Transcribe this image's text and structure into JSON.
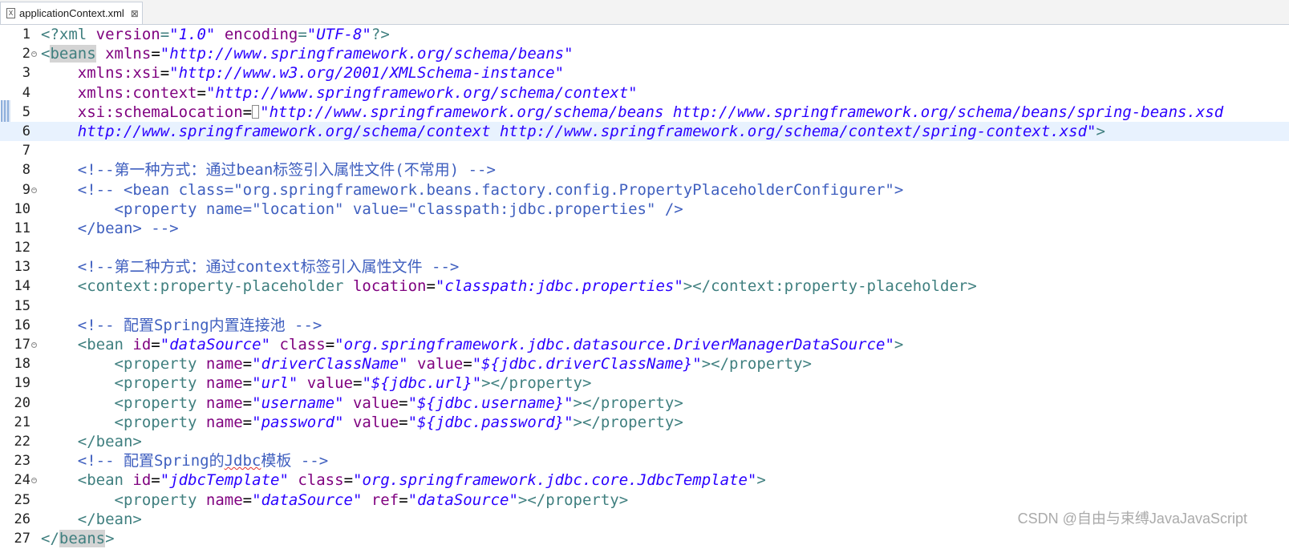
{
  "tab": {
    "file_name": "applicationContext.xml",
    "close_glyph": "⊠",
    "icon_letter": "X"
  },
  "editor": {
    "lines": [
      {
        "n": "1",
        "code": [
          [
            "pi",
            "<?xml "
          ],
          [
            "attr",
            "version"
          ],
          [
            "pi",
            "="
          ],
          [
            "val",
            "\"1.0\""
          ],
          [
            "pi",
            " "
          ],
          [
            "attr",
            "encoding"
          ],
          [
            "pi",
            "="
          ],
          [
            "val",
            "\"UTF-8\""
          ],
          [
            "pi",
            "?>"
          ]
        ]
      },
      {
        "n": "2",
        "fold": true,
        "code": [
          [
            "tag",
            "<"
          ],
          [
            "taghl",
            "beans"
          ],
          [
            "tag",
            " "
          ],
          [
            "attr",
            "xmlns"
          ],
          [
            "plain",
            "="
          ],
          [
            "val",
            "\"http://www.springframework.org/schema/beans\""
          ]
        ]
      },
      {
        "n": "3",
        "code": [
          [
            "plain",
            "    "
          ],
          [
            "attr",
            "xmlns:xsi"
          ],
          [
            "plain",
            "="
          ],
          [
            "val",
            "\"http://www.w3.org/2001/XMLSchema-instance\""
          ]
        ]
      },
      {
        "n": "4",
        "code": [
          [
            "plain",
            "    "
          ],
          [
            "attr",
            "xmlns:context"
          ],
          [
            "plain",
            "="
          ],
          [
            "val",
            "\"http://www.springframework.org/schema/context\""
          ]
        ]
      },
      {
        "n": "5",
        "code": [
          [
            "plain",
            "    "
          ],
          [
            "attr",
            "xsi:schemaLocation"
          ],
          [
            "plain",
            "="
          ],
          [
            "caret",
            ""
          ],
          [
            "val",
            "\"http://www.springframework.org/schema/beans http://www.springframework.org/schema/beans/spring-beans.xsd"
          ]
        ]
      },
      {
        "n": "6",
        "current": true,
        "code": [
          [
            "plain",
            "    "
          ],
          [
            "val",
            "http://www.springframework.org/schema/context http://www.springframework.org/schema/context/spring-context.xsd\""
          ],
          [
            "tag",
            ">"
          ]
        ]
      },
      {
        "n": "7",
        "code": []
      },
      {
        "n": "8",
        "code": [
          [
            "plain",
            "    "
          ],
          [
            "cmt",
            "<!--第一种方式：通过bean标签引入属性文件(不常用) -->"
          ]
        ]
      },
      {
        "n": "9",
        "fold": true,
        "code": [
          [
            "plain",
            "    "
          ],
          [
            "cmt",
            "<!-- <bean class=\"org.springframework.beans.factory.config.PropertyPlaceholderConfigurer\">"
          ]
        ]
      },
      {
        "n": "10",
        "code": [
          [
            "plain",
            "        "
          ],
          [
            "cmt",
            "<property name=\"location\" value=\"classpath:jdbc.properties\" />"
          ]
        ]
      },
      {
        "n": "11",
        "code": [
          [
            "plain",
            "    "
          ],
          [
            "cmt",
            "</bean> -->"
          ]
        ]
      },
      {
        "n": "12",
        "code": []
      },
      {
        "n": "13",
        "code": [
          [
            "plain",
            "    "
          ],
          [
            "cmt",
            "<!--第二种方式：通过context标签引入属性文件 -->"
          ]
        ]
      },
      {
        "n": "14",
        "code": [
          [
            "plain",
            "    "
          ],
          [
            "tag",
            "<context:property-placeholder "
          ],
          [
            "attr",
            "location"
          ],
          [
            "plain",
            "="
          ],
          [
            "val",
            "\"classpath:jdbc.properties\""
          ],
          [
            "tag",
            "></context:property-placeholder>"
          ]
        ]
      },
      {
        "n": "15",
        "code": []
      },
      {
        "n": "16",
        "code": [
          [
            "plain",
            "    "
          ],
          [
            "cmt",
            "<!-- 配置Spring内置连接池 -->"
          ]
        ]
      },
      {
        "n": "17",
        "fold": true,
        "code": [
          [
            "plain",
            "    "
          ],
          [
            "tag",
            "<bean "
          ],
          [
            "attr",
            "id"
          ],
          [
            "plain",
            "="
          ],
          [
            "val",
            "\"dataSource\""
          ],
          [
            "plain",
            " "
          ],
          [
            "attr",
            "class"
          ],
          [
            "plain",
            "="
          ],
          [
            "val",
            "\"org.springframework.jdbc.datasource.DriverManagerDataSource\""
          ],
          [
            "tag",
            ">"
          ]
        ]
      },
      {
        "n": "18",
        "code": [
          [
            "plain",
            "        "
          ],
          [
            "tag",
            "<property "
          ],
          [
            "attr",
            "name"
          ],
          [
            "plain",
            "="
          ],
          [
            "val",
            "\"driverClassName\""
          ],
          [
            "plain",
            " "
          ],
          [
            "attr",
            "value"
          ],
          [
            "plain",
            "="
          ],
          [
            "val",
            "\"${jdbc.driverClassName}\""
          ],
          [
            "tag",
            "></property>"
          ]
        ]
      },
      {
        "n": "19",
        "code": [
          [
            "plain",
            "        "
          ],
          [
            "tag",
            "<property "
          ],
          [
            "attr",
            "name"
          ],
          [
            "plain",
            "="
          ],
          [
            "val",
            "\"url\""
          ],
          [
            "plain",
            " "
          ],
          [
            "attr",
            "value"
          ],
          [
            "plain",
            "="
          ],
          [
            "val",
            "\"${jdbc.url}\""
          ],
          [
            "tag",
            "></property>"
          ]
        ]
      },
      {
        "n": "20",
        "code": [
          [
            "plain",
            "        "
          ],
          [
            "tag",
            "<property "
          ],
          [
            "attr",
            "name"
          ],
          [
            "plain",
            "="
          ],
          [
            "val",
            "\"username\""
          ],
          [
            "plain",
            " "
          ],
          [
            "attr",
            "value"
          ],
          [
            "plain",
            "="
          ],
          [
            "val",
            "\"${jdbc.username}\""
          ],
          [
            "tag",
            "></property>"
          ]
        ]
      },
      {
        "n": "21",
        "code": [
          [
            "plain",
            "        "
          ],
          [
            "tag",
            "<property "
          ],
          [
            "attr",
            "name"
          ],
          [
            "plain",
            "="
          ],
          [
            "val",
            "\"password\""
          ],
          [
            "plain",
            " "
          ],
          [
            "attr",
            "value"
          ],
          [
            "plain",
            "="
          ],
          [
            "val",
            "\"${jdbc.password}\""
          ],
          [
            "tag",
            "></property>"
          ]
        ]
      },
      {
        "n": "22",
        "code": [
          [
            "plain",
            "    "
          ],
          [
            "tag",
            "</bean>"
          ]
        ]
      },
      {
        "n": "23",
        "code": [
          [
            "plain",
            "    "
          ],
          [
            "cmt",
            "<!-- 配置Spring的"
          ],
          [
            "cmtsq",
            "Jdbc"
          ],
          [
            "cmt",
            "模板 -->"
          ]
        ]
      },
      {
        "n": "24",
        "fold": true,
        "code": [
          [
            "plain",
            "    "
          ],
          [
            "tag",
            "<bean "
          ],
          [
            "attr",
            "id"
          ],
          [
            "plain",
            "="
          ],
          [
            "val",
            "\"jdbcTemplate\""
          ],
          [
            "plain",
            " "
          ],
          [
            "attr",
            "class"
          ],
          [
            "plain",
            "="
          ],
          [
            "val",
            "\"org.springframework.jdbc.core.JdbcTemplate\""
          ],
          [
            "tag",
            ">"
          ]
        ]
      },
      {
        "n": "25",
        "code": [
          [
            "plain",
            "        "
          ],
          [
            "tag",
            "<property "
          ],
          [
            "attr",
            "name"
          ],
          [
            "plain",
            "="
          ],
          [
            "val",
            "\"dataSource\""
          ],
          [
            "plain",
            " "
          ],
          [
            "attr",
            "ref"
          ],
          [
            "plain",
            "="
          ],
          [
            "val",
            "\"dataSource\""
          ],
          [
            "tag",
            "></property>"
          ]
        ]
      },
      {
        "n": "26",
        "code": [
          [
            "plain",
            "    "
          ],
          [
            "tag",
            "</bean>"
          ]
        ]
      },
      {
        "n": "27",
        "code": [
          [
            "tag",
            "</"
          ],
          [
            "taghl",
            "beans"
          ],
          [
            "tag",
            ">"
          ]
        ]
      }
    ]
  },
  "watermark": "CSDN @自由与束缚JavaJavaScript",
  "colors": {
    "tag": "#3f7f7f",
    "attribute": "#7f007f",
    "value": "#2a00ff",
    "comment": "#3f5fbf",
    "current_line": "#e8f2fe"
  }
}
